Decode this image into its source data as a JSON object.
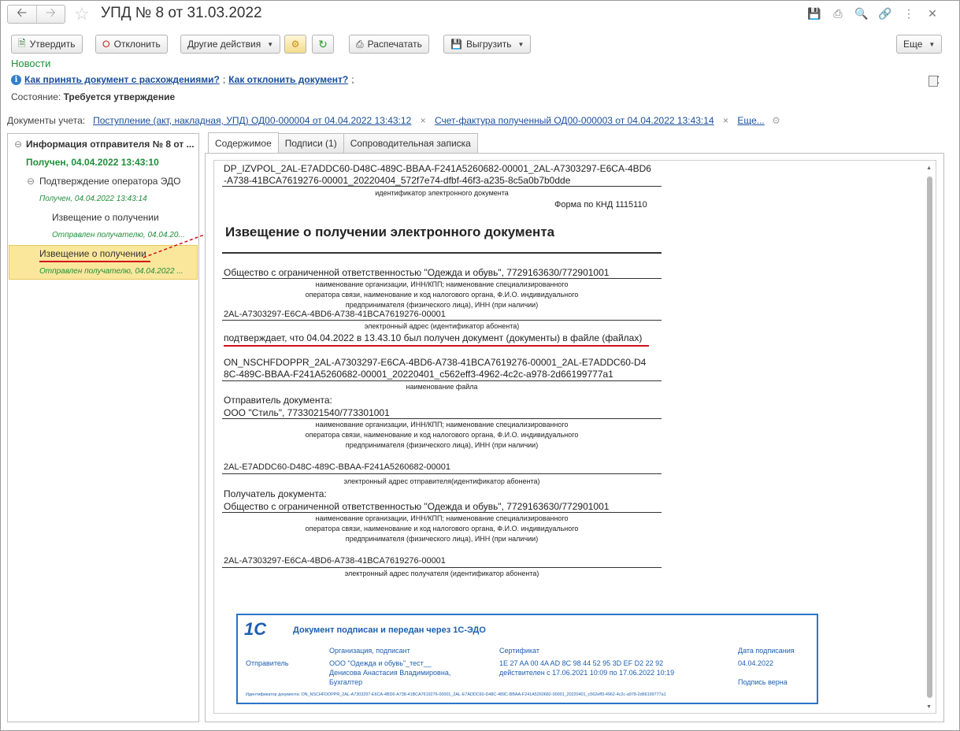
{
  "window": {
    "title": "УПД № 8 от 31.03.2022"
  },
  "toolbar": {
    "approve": "Утвердить",
    "reject": "Отклонить",
    "other_actions": "Другие действия",
    "print": "Распечатать",
    "export": "Выгрузить",
    "more": "Еще"
  },
  "news_label": "Новости",
  "help": {
    "link1": "Как принять документ с расхождениями?",
    "sep": ";",
    "link2": "Как отклонить документ?",
    "end": ";"
  },
  "status": {
    "label": "Состояние:",
    "value": "Требуется утверждение"
  },
  "accounting_docs": {
    "label": "Документы учета:",
    "doc1": "Поступление (акт, накладная, УПД) ОД00-000004 от 04.04.2022 13:43:12",
    "doc2": "Счет-фактура полученный ОД00-000003 от 04.04.2022 13:43:14",
    "more": "Еще..."
  },
  "tree": {
    "root": "Информация отправителя № 8 от ...",
    "root_status": "Получен, 04.04.2022 13:43:10",
    "node1": "Подтверждение оператора ЭДО",
    "node1_status": "Получен, 04.04.2022 13:43:14",
    "node2": "Извещение о получении",
    "node2_status": "Отправлен получателю, 04.04.20...",
    "node3": "Извещение о получении",
    "node3_status": "Отправлен получателю, 04.04.2022 ..."
  },
  "tabs": [
    "Содержимое",
    "Подписи (1)",
    "Сопроводительная записка"
  ],
  "document": {
    "id_line1": "DP_IZVPOL_2AL-E7ADDC60-D48C-489C-BBAA-F241A5260682-00001_2AL-A7303297-E6CA-4BD6",
    "id_line2": "-A738-41BCA7619276-00001_20220404_572f7e74-dfbf-46f3-a235-8c5a0b7b0dde",
    "id_caption": "идентификатор электронного документа",
    "form": "Форма по КНД 1115110",
    "heading": "Извещение о получении электронного документа",
    "org": "Общество с ограниченной ответственностью \"Одежда и обувь\", 7729163630/772901001",
    "org_caption1": "наименование организации, ИНН/КПП; наименование специализированного",
    "org_caption2": "оператора связи, наименование и код налогового органа, Ф.И.О. индивидуального",
    "org_caption3": "предпринимателя (физического лица), ИНН (при наличии)",
    "org_address": "2AL-A7303297-E6CA-4BD6-A738-41BCA7619276-00001",
    "org_address_caption": "электронный адрес (идентификатор абонента)",
    "confirm": "подтверждает, что 04.04.2022 в 13.43.10 был получен документ (документы) в файле (файлах)",
    "file_line1": "ON_NSCHFDOPPR_2AL-A7303297-E6CA-4BD6-A738-41BCA7619276-00001_2AL-E7ADDC60-D4",
    "file_line2": "8C-489C-BBAA-F241A5260682-00001_20220401_c562eff3-4962-4c2c-a978-2d66199777a1",
    "file_caption": "наименование файла",
    "sender_label": "Отправитель документа:",
    "sender": "ООО \"Стиль\", 7733021540/773301001",
    "sender_caption1": "наименование организации, ИНН/КПП; наименование специализированного",
    "sender_caption2": "оператора связи, наименование и код налогового органа, Ф.И.О. индивидуального",
    "sender_caption3": "предпринимателя (физического лица), ИНН (при наличии)",
    "sender_address": "2AL-E7ADDC60-D48C-489C-BBAA-F241A5260682-00001",
    "sender_address_caption": "электронный адрес отправителя(идентификатор абонента)",
    "recipient_label": "Получатель документа:",
    "recipient": "Общество с ограниченной ответственностью \"Одежда и обувь\", 7729163630/772901001",
    "recipient_caption1": "наименование организации, ИНН/КПП; наименование специализированного",
    "recipient_caption2": "оператора связи, наименование и код налогового органа, Ф.И.О. индивидуального",
    "recipient_caption3": "предпринимателя (физического лица), ИНН (при наличии)",
    "recipient_address": "2AL-A7303297-E6CA-4BD6-A738-41BCA7619276-00001",
    "recipient_address_caption": "электронный адрес получателя (идентификатор абонента)"
  },
  "stamp": {
    "logo": "1С",
    "title": "Документ подписан и передан через 1С-ЭДО",
    "col_org": "Организация, подписант",
    "col_cert": "Сертификат",
    "col_date": "Дата подписания",
    "role": "Отправитель",
    "org_line1": "ООО \"Одежда и обувь\"_тест__",
    "org_line2": "Денисова Анастасия Владимировна,",
    "org_line3": "Бухгалтер",
    "cert_line1": "1E 27 AA 00 4A AD 8C 98 44 52 95 3D EF D2 22 92",
    "cert_line2": "действителен с 17.06.2021 10:09 по 17.06.2022 10:19",
    "date": "04.04.2022",
    "valid": "Подпись верна",
    "doc_id": "Идентификатор документа: ON_NSCHFDOPPR_2AL-A7303297-E6CA-4BD6-A738-41BCA7619276-00001_2AL-E7ADDC60-D48C-489C-BBAA-F241A5260682-00001_20220401_c562eff3-4962-4c2c-a978-2d66199777a1"
  },
  "colors": {
    "accent_green": "#1f8f3a",
    "link_blue": "#1a4f9c",
    "selection": "#fbe79c",
    "annotation_red": "#d0101a",
    "stamp_blue": "#2a73c7"
  }
}
